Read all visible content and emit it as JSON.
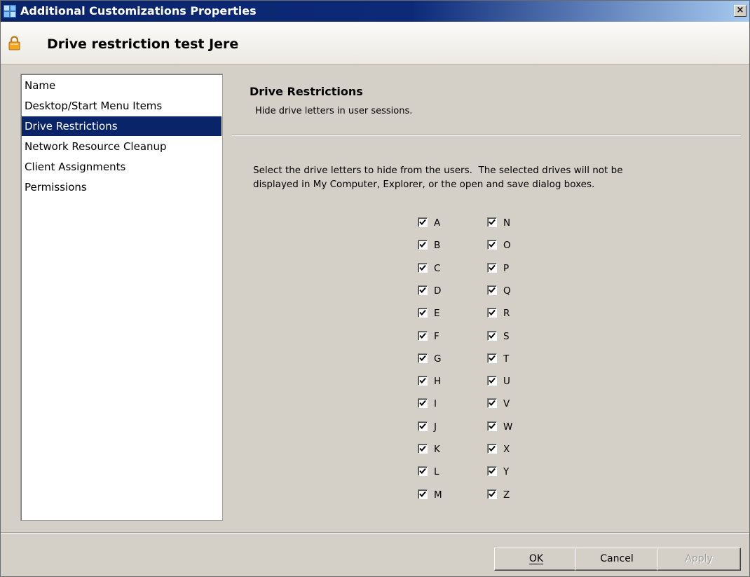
{
  "window": {
    "title": "Additional Customizations Properties",
    "close_glyph": "×"
  },
  "header": {
    "title": "Drive restriction test Jere",
    "icon": "lock-icon"
  },
  "nav": {
    "items": [
      {
        "label": "Name",
        "selected": false
      },
      {
        "label": "Desktop/Start Menu Items",
        "selected": false
      },
      {
        "label": "Drive Restrictions",
        "selected": true
      },
      {
        "label": "Network Resource Cleanup",
        "selected": false
      },
      {
        "label": "Client Assignments",
        "selected": false
      },
      {
        "label": "Permissions",
        "selected": false
      }
    ]
  },
  "pane": {
    "title": "Drive Restrictions",
    "subtitle": "Hide drive letters in user sessions.",
    "instructions_line1": "Select the drive letters to hide from the users.  The selected drives will not be",
    "instructions_line2": "displayed in My Computer, Explorer, or the open and save dialog boxes."
  },
  "drives": [
    {
      "letter": "A",
      "checked": true
    },
    {
      "letter": "B",
      "checked": true
    },
    {
      "letter": "C",
      "checked": true
    },
    {
      "letter": "D",
      "checked": true
    },
    {
      "letter": "E",
      "checked": true
    },
    {
      "letter": "F",
      "checked": true
    },
    {
      "letter": "G",
      "checked": true
    },
    {
      "letter": "H",
      "checked": true
    },
    {
      "letter": "I",
      "checked": true
    },
    {
      "letter": "J",
      "checked": true
    },
    {
      "letter": "K",
      "checked": true
    },
    {
      "letter": "L",
      "checked": true
    },
    {
      "letter": "M",
      "checked": true
    },
    {
      "letter": "N",
      "checked": true
    },
    {
      "letter": "O",
      "checked": true
    },
    {
      "letter": "P",
      "checked": true
    },
    {
      "letter": "Q",
      "checked": true
    },
    {
      "letter": "R",
      "checked": true
    },
    {
      "letter": "S",
      "checked": true
    },
    {
      "letter": "T",
      "checked": true
    },
    {
      "letter": "U",
      "checked": true
    },
    {
      "letter": "V",
      "checked": true
    },
    {
      "letter": "W",
      "checked": true
    },
    {
      "letter": "X",
      "checked": true
    },
    {
      "letter": "Y",
      "checked": true
    },
    {
      "letter": "Z",
      "checked": true
    }
  ],
  "buttons": {
    "ok": {
      "label": "OK",
      "enabled": true
    },
    "cancel": {
      "label": "Cancel",
      "enabled": true
    },
    "apply": {
      "label": "Apply",
      "enabled": false
    }
  },
  "colors": {
    "titlebar": "#0a246a",
    "selection": "#0a246a",
    "face": "#d4d0c8"
  }
}
